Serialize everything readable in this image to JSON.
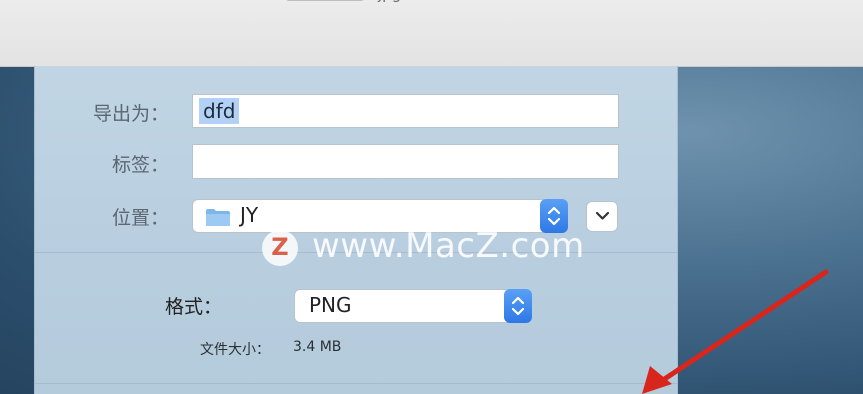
{
  "window": {
    "title_extension": "jpg"
  },
  "export_sheet": {
    "export_as_label": "导出为：",
    "export_as_value": "dfd",
    "tags_label": "标签：",
    "tags_value": "",
    "location_label": "位置：",
    "location_value": "JY",
    "format_label": "格式：",
    "format_value": "PNG",
    "file_size_label": "文件大小：",
    "file_size_value": "3.4 MB"
  },
  "watermark": {
    "logo_letter": "Z",
    "text": "www.MacZ.com"
  },
  "colors": {
    "accent": "#2d78e6",
    "sheet_background": "#bfd3e2",
    "annotation_arrow": "#d9261c",
    "desktop": "#3e6382"
  },
  "icons": {
    "folder": "folder-icon",
    "stepper": "up-down-chevron-icon",
    "expand": "chevron-down-icon"
  }
}
